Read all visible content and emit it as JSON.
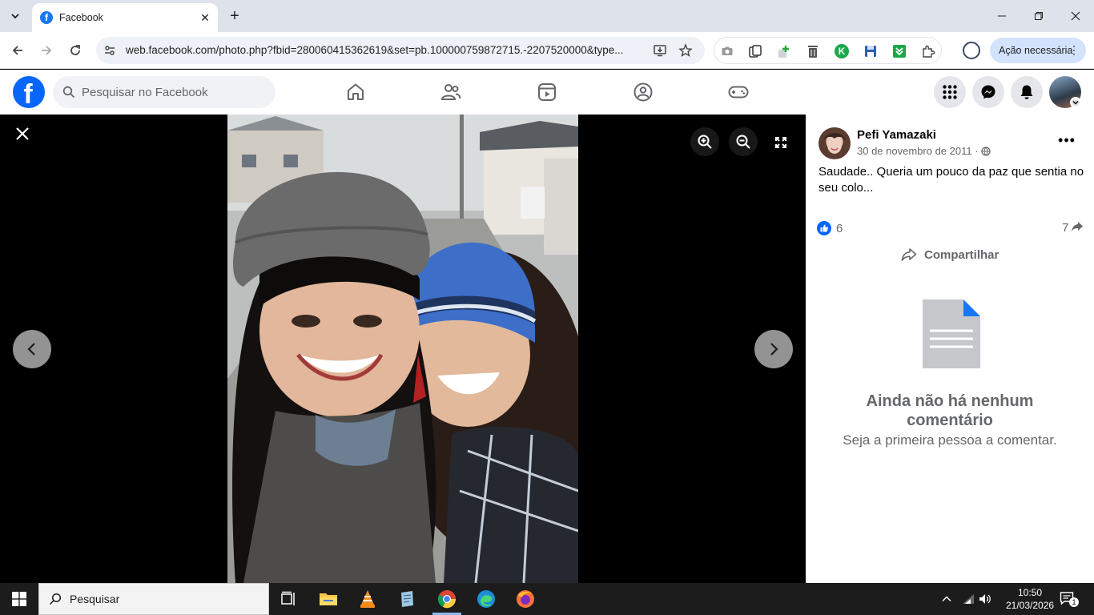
{
  "browser": {
    "tab_title": "Facebook",
    "favicon_letter": "f",
    "url": "web.facebook.com/photo.php?fbid=280060415362619&set=pb.100000759872715.-2207520000&type...",
    "action_button": "Ação necessária"
  },
  "facebook": {
    "logo_letter": "f",
    "search_placeholder": "Pesquisar no Facebook"
  },
  "post": {
    "author": "Pefi Yamazaki",
    "date": "30 de novembro de 2011 ·",
    "caption": "Saudade.. Queria um pouco da paz que sentia no seu colo...",
    "likes": "6",
    "shares": "7",
    "share_label": "Compartilhar",
    "empty_title": "Ainda não há nenhum comentário",
    "empty_subtitle": "Seja a primeira pessoa a comentar."
  },
  "taskbar": {
    "search_placeholder": "Pesquisar",
    "time": "10:50",
    "date": "21/03/2026",
    "notification_count": "1"
  },
  "colors": {
    "facebook_blue": "#0866ff",
    "chrome_tab_strip": "#dee3eb",
    "action_pill": "#d3e3fd"
  }
}
